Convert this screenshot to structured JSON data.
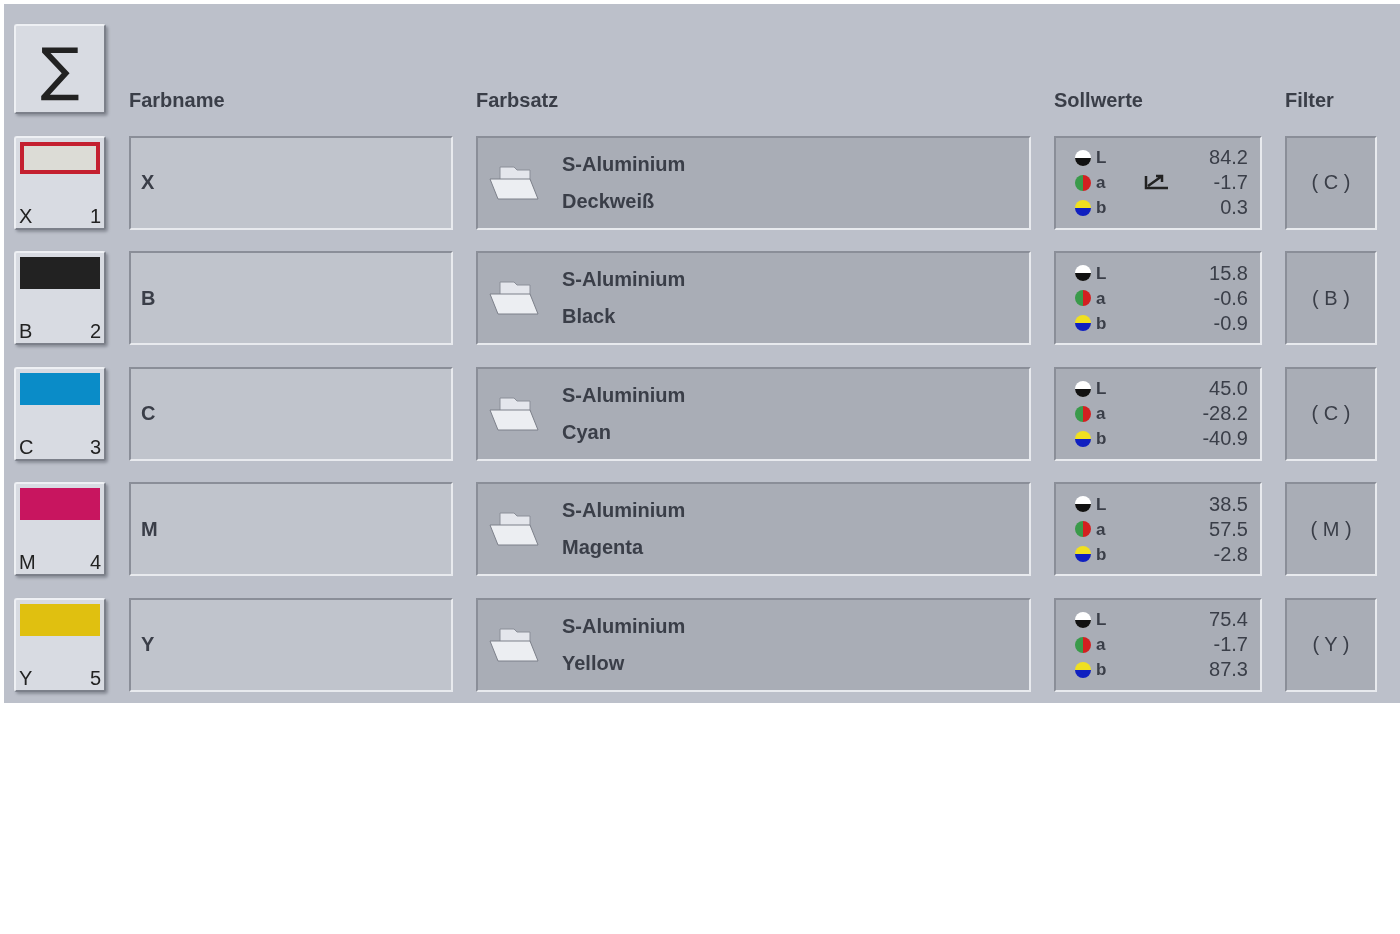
{
  "header": {
    "sum_button": "∑",
    "columns": [
      "Farbname",
      "Farbsatz",
      "Sollwerte",
      "Filter"
    ]
  },
  "rows": [
    {
      "swatch": {
        "letter": "X",
        "number": "1",
        "color": "#dcdcd6",
        "selected": true
      },
      "name": "X",
      "set": [
        "S-Aluminium",
        "Deckweiß"
      ],
      "lab": [
        {
          "label": "L",
          "value": "84.2"
        },
        {
          "label": "a",
          "value": "-1.7"
        },
        {
          "label": "b",
          "value": "0.3"
        }
      ],
      "adjusted": true,
      "filter": "( C )"
    },
    {
      "swatch": {
        "letter": "B",
        "number": "2",
        "color": "#222222",
        "selected": false
      },
      "name": "B",
      "set": [
        "S-Aluminium",
        "Black"
      ],
      "lab": [
        {
          "label": "L",
          "value": "15.8"
        },
        {
          "label": "a",
          "value": "-0.6"
        },
        {
          "label": "b",
          "value": "-0.9"
        }
      ],
      "adjusted": false,
      "filter": "( B )"
    },
    {
      "swatch": {
        "letter": "C",
        "number": "3",
        "color": "#0a8cc8",
        "selected": false
      },
      "name": "C",
      "set": [
        "S-Aluminium",
        "Cyan"
      ],
      "lab": [
        {
          "label": "L",
          "value": "45.0"
        },
        {
          "label": "a",
          "value": "-28.2"
        },
        {
          "label": "b",
          "value": "-40.9"
        }
      ],
      "adjusted": false,
      "filter": "( C )"
    },
    {
      "swatch": {
        "letter": "M",
        "number": "4",
        "color": "#c8155f",
        "selected": false
      },
      "name": "M",
      "set": [
        "S-Aluminium",
        "Magenta"
      ],
      "lab": [
        {
          "label": "L",
          "value": "38.5"
        },
        {
          "label": "a",
          "value": "57.5"
        },
        {
          "label": "b",
          "value": "-2.8"
        }
      ],
      "adjusted": false,
      "filter": "( M )"
    },
    {
      "swatch": {
        "letter": "Y",
        "number": "5",
        "color": "#e0c010",
        "selected": false
      },
      "name": "Y",
      "set": [
        "S-Aluminium",
        "Yellow"
      ],
      "lab": [
        {
          "label": "L",
          "value": "75.4"
        },
        {
          "label": "a",
          "value": "-1.7"
        },
        {
          "label": "b",
          "value": "87.3"
        }
      ],
      "adjusted": false,
      "filter": "( Y )"
    }
  ]
}
